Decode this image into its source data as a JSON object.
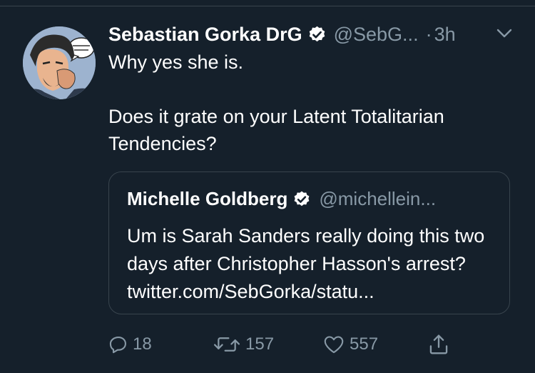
{
  "tweet": {
    "author_name": "Sebastian Gorka DrG",
    "author_handle": "@SebG...",
    "separator": "·",
    "timestamp": "3h",
    "text_line1": "Why yes she is.",
    "text_line2": "Does it grate on your Latent Totalitarian Tendencies?",
    "avatar_speech": "WE'RE ON OUR WAY"
  },
  "quoted_tweet": {
    "author_name": "Michelle Goldberg",
    "author_handle": "@michellein...",
    "text": "Um is Sarah Sanders really doing this two days after Christopher Hasson's arrest? twitter.com/SebGorka/statu..."
  },
  "actions": {
    "reply_count": "18",
    "retweet_count": "157",
    "like_count": "557"
  },
  "colors": {
    "background": "#15202b",
    "text_primary": "#ffffff",
    "text_secondary": "#8899a6",
    "border": "#38444d"
  },
  "icons": [
    "verified-badge-icon",
    "chevron-down-icon",
    "reply-icon",
    "retweet-icon",
    "like-icon",
    "share-icon"
  ]
}
